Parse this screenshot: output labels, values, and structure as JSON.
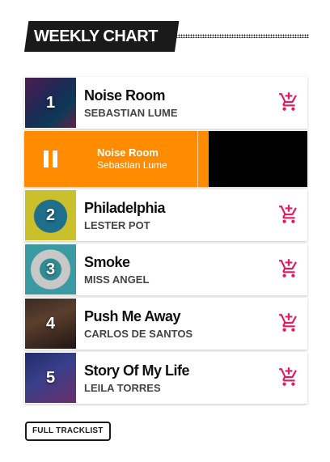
{
  "header": {
    "title": "WEEKLY CHART"
  },
  "accent_color": "#ff8c00",
  "cart_color": "#e5195e",
  "tracks": [
    {
      "rank": "1",
      "title": "Noise Room",
      "artist": "SEBASTIAN LUME",
      "cover_icon": "album-cover-noise-room"
    },
    {
      "rank": "2",
      "title": "Philadelphia",
      "artist": "LESTER POT",
      "cover_icon": "album-cover-philadelphia"
    },
    {
      "rank": "3",
      "title": "Smoke",
      "artist": "MISS ANGEL",
      "cover_icon": "album-cover-smoke"
    },
    {
      "rank": "4",
      "title": "Push Me Away",
      "artist": "CARLOS DE SANTOS",
      "cover_icon": "album-cover-push-me-away"
    },
    {
      "rank": "5",
      "title": "Story Of My Life",
      "artist": "LEILA TORRES",
      "cover_icon": "album-cover-story-of-my-life"
    }
  ],
  "player": {
    "title": "Noise Room",
    "artist": "Sebastian Lume",
    "state": "playing",
    "progress": 0.65
  },
  "footer": {
    "full_tracklist_label": "FULL TRACKLIST"
  }
}
